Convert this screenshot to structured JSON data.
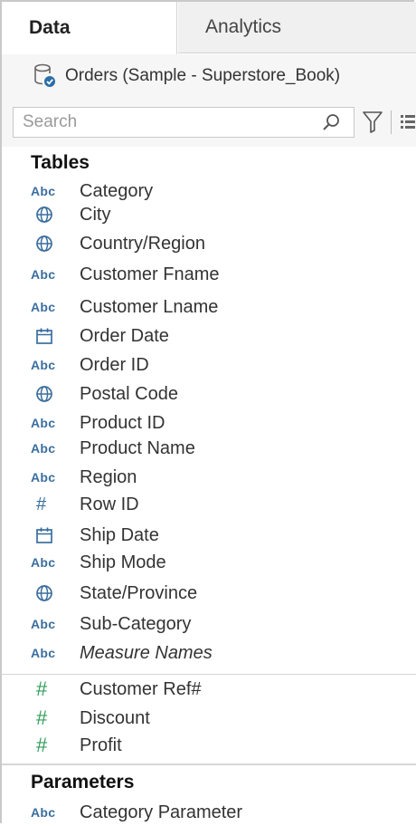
{
  "tabs": {
    "data": "Data",
    "analytics": "Analytics"
  },
  "datasource": {
    "name": "Orders (Sample - Superstore_Book)",
    "icon": "datasource-icon"
  },
  "search": {
    "placeholder": "Search"
  },
  "sections": {
    "tables": "Tables",
    "parameters": "Parameters"
  },
  "fields": [
    {
      "type": "abc",
      "label": "Category"
    },
    {
      "type": "geo",
      "label": "City"
    },
    {
      "type": "geo",
      "label": "Country/Region"
    },
    {
      "type": "abc",
      "label": "Customer Fname"
    },
    {
      "type": "abc",
      "label": "Customer Lname"
    },
    {
      "type": "date",
      "label": "Order Date"
    },
    {
      "type": "abc",
      "label": "Order ID"
    },
    {
      "type": "geo",
      "label": "Postal Code"
    },
    {
      "type": "abc",
      "label": "Product ID"
    },
    {
      "type": "abc",
      "label": "Product Name"
    },
    {
      "type": "abc",
      "label": "Region"
    },
    {
      "type": "num-blue",
      "label": "Row ID"
    },
    {
      "type": "date",
      "label": "Ship Date"
    },
    {
      "type": "abc",
      "label": "Ship Mode"
    },
    {
      "type": "geo",
      "label": "State/Province"
    },
    {
      "type": "abc",
      "label": "Sub-Category"
    },
    {
      "type": "abc",
      "label": "Measure Names"
    }
  ],
  "measures": [
    {
      "type": "num-green",
      "label": "Customer Ref#"
    },
    {
      "type": "num-green",
      "label": "Discount"
    },
    {
      "type": "num-green",
      "label": "Profit"
    }
  ],
  "parameters": [
    {
      "type": "abc",
      "label": "Category Parameter"
    }
  ],
  "type_glyphs": {
    "abc": "Abc",
    "num": "#"
  },
  "colors": {
    "dimension": "#3b6e9e",
    "measure": "#2f9e5a"
  }
}
